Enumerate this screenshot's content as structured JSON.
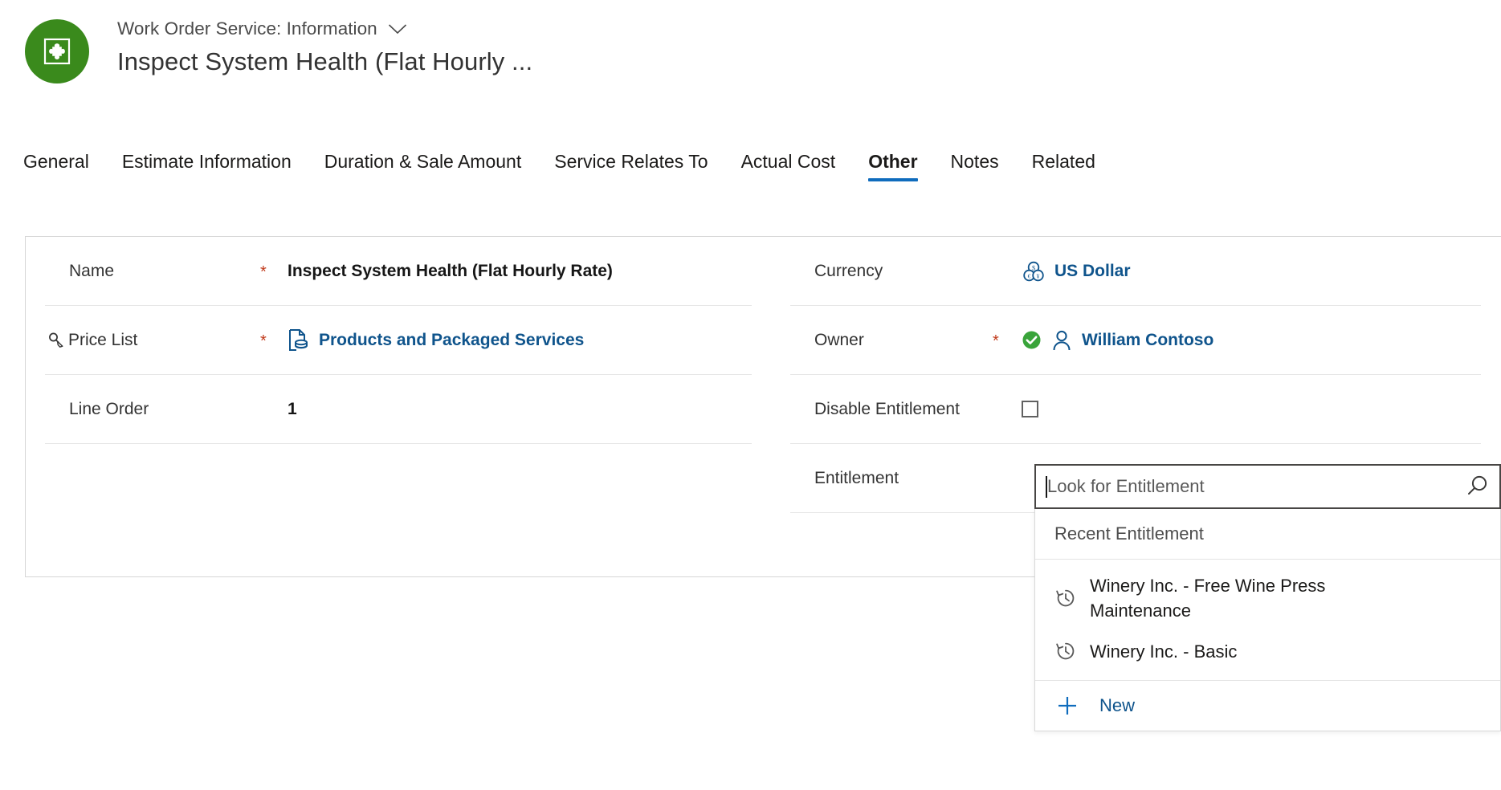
{
  "header": {
    "breadcrumb": "Work Order Service: Information",
    "title": "Inspect System Health (Flat Hourly ...",
    "avatar_icon": "puzzle-piece-icon",
    "avatar_color": "#3a8a1c",
    "chevron_icon": "chevron-down-icon"
  },
  "tabs": [
    {
      "label": "General",
      "active": false
    },
    {
      "label": "Estimate Information",
      "active": false
    },
    {
      "label": "Duration & Sale Amount",
      "active": false
    },
    {
      "label": "Service Relates To",
      "active": false
    },
    {
      "label": "Actual Cost",
      "active": false
    },
    {
      "label": "Other",
      "active": true
    },
    {
      "label": "Notes",
      "active": false
    },
    {
      "label": "Related",
      "active": false
    }
  ],
  "accent_color": "#0f6cbd",
  "link_color": "#0f548c",
  "required_color": "#c0391a",
  "form": {
    "left_fields": [
      {
        "label": "Name",
        "required": true,
        "value": "Inspect System Health (Flat Hourly Rate)",
        "type": "text"
      },
      {
        "label": "Price List",
        "required": true,
        "value": "Products and Packaged Services",
        "type": "link",
        "label_icon": "lookup-search-icon",
        "value_icon": "price-list-document-icon"
      },
      {
        "label": "Line Order",
        "required": false,
        "value": "1",
        "type": "text"
      }
    ],
    "right_fields": [
      {
        "label": "Currency",
        "required": false,
        "value": "US Dollar",
        "type": "link",
        "value_icon": "currency-coins-icon"
      },
      {
        "label": "Owner",
        "required": true,
        "value": "William Contoso",
        "type": "link",
        "value_icon": "user-person-icon",
        "status_icon": "green-check-badge-icon"
      },
      {
        "label": "Disable Entitlement",
        "required": false,
        "value": "",
        "type": "checkbox",
        "checked": false
      },
      {
        "label": "Entitlement",
        "required": false,
        "value": "",
        "type": "lookup"
      }
    ]
  },
  "lookup": {
    "placeholder": "Look for Entitlement",
    "value": "",
    "search_icon": "search-magnifier-icon",
    "section_header": "Recent Entitlement",
    "items": [
      {
        "label": "Winery Inc. - Free Wine Press Maintenance",
        "icon": "recent-history-clock-icon"
      },
      {
        "label": "Winery Inc. - Basic",
        "icon": "recent-history-clock-icon"
      }
    ],
    "new_label": "New",
    "new_icon": "plus-icon"
  }
}
